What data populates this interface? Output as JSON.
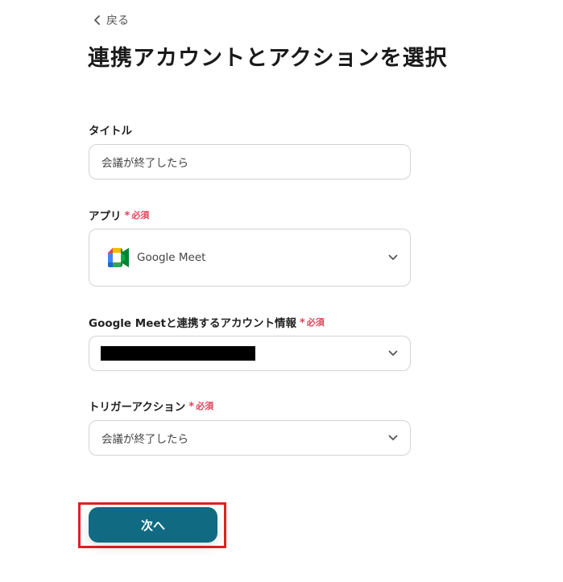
{
  "header": {
    "back_label": "戻る",
    "title": "連携アカウントとアクションを選択"
  },
  "form": {
    "title_field": {
      "label": "タイトル",
      "value": "会議が終了したら"
    },
    "app_field": {
      "label": "アプリ",
      "required_mark": "*",
      "required_label": "必須",
      "selected_app": "Google Meet",
      "app_icon": "google-meet-icon"
    },
    "account_field": {
      "label": "Google Meetと連携するアカウント情報",
      "required_mark": "*",
      "required_label": "必須",
      "value_redacted": true
    },
    "trigger_field": {
      "label": "トリガーアクション",
      "required_mark": "*",
      "required_label": "必須",
      "value": "会議が終了したら"
    }
  },
  "actions": {
    "next_label": "次へ"
  },
  "colors": {
    "primary_button": "#0f6a82",
    "required": "#e2445c",
    "highlight_border": "#e02020"
  }
}
